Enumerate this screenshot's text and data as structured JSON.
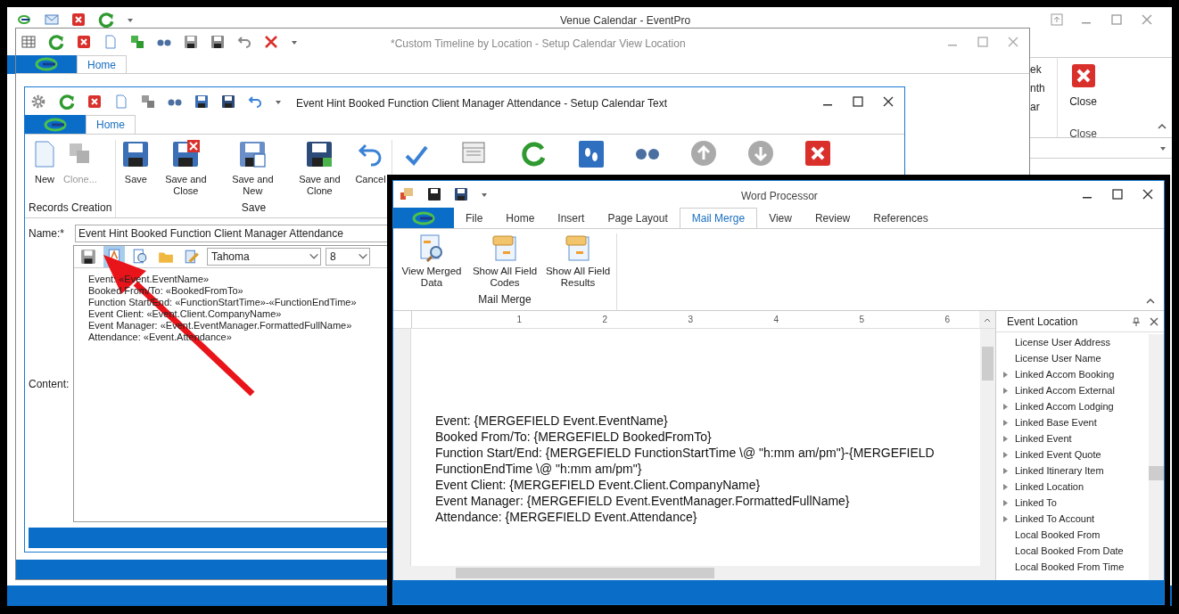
{
  "main_window": {
    "title": "Venue Calendar - EventPro",
    "ribbon_fragments": [
      "ek",
      "nth",
      "ar"
    ],
    "close_button": "Close",
    "close_group": "Close"
  },
  "timeline_window": {
    "title": "*Custom Timeline by Location - Setup Calendar View Location",
    "tab": "Home"
  },
  "text_window": {
    "title": "Event Hint Booked Function Client Manager Attendance - Setup Calendar Text",
    "tab": "Home",
    "groups": [
      {
        "label": "Records Creation",
        "buttons": [
          {
            "label": "New",
            "kind": "new",
            "disabled": false
          },
          {
            "label": "Clone...",
            "kind": "clone",
            "disabled": true
          }
        ]
      },
      {
        "label": "Save",
        "buttons": [
          {
            "label": "Save",
            "kind": "save",
            "disabled": false
          },
          {
            "label": "Save and Close",
            "kind": "save_close",
            "disabled": false
          },
          {
            "label": "Save and New",
            "kind": "save_new",
            "disabled": false
          },
          {
            "label": "Save and Clone",
            "kind": "save_clone",
            "disabled": false
          },
          {
            "label": "Cancel",
            "kind": "cancel",
            "disabled": false
          }
        ]
      }
    ],
    "name_label": "Name:*",
    "name_value": "Event Hint Booked Function Client Manager Attendance",
    "editor_toolbar": [
      {
        "kind": "save",
        "highlighted": false
      },
      {
        "kind": "text",
        "highlighted": true
      },
      {
        "kind": "find",
        "highlighted": false
      },
      {
        "kind": "open",
        "highlighted": false
      },
      {
        "kind": "edit",
        "highlighted": false
      }
    ],
    "font": "Tahoma",
    "font_size": "8",
    "content_label": "Content:",
    "content_lines": [
      "Event: «Event.EventName»",
      "Booked From/To: «BookedFromTo»",
      "Function Start/End: «FunctionStartTime»-«FunctionEndTime»",
      "Event Client: «Event.Client.CompanyName»",
      "Event Manager: «Event.EventManager.FormattedFullName»",
      "Attendance: «Event.Attendance»"
    ]
  },
  "word_processor": {
    "title": "Word Processor",
    "tabs": [
      {
        "label": "File",
        "selected": false
      },
      {
        "label": "Home",
        "selected": false
      },
      {
        "label": "Insert",
        "selected": false
      },
      {
        "label": "Page Layout",
        "selected": false
      },
      {
        "label": "Mail Merge",
        "selected": true
      },
      {
        "label": "View",
        "selected": false
      },
      {
        "label": "Review",
        "selected": false
      },
      {
        "label": "References",
        "selected": false
      }
    ],
    "buttons": [
      {
        "label": "View Merged Data",
        "kind": "view_merged"
      },
      {
        "label": "Show All Field Codes",
        "kind": "field_codes"
      },
      {
        "label": "Show All Field Results",
        "kind": "field_results"
      }
    ],
    "group": "Mail Merge",
    "ruler_numbers": [
      "1",
      "2",
      "3",
      "4",
      "5",
      "6"
    ],
    "document_lines": [
      "Event: {MERGEFIELD Event.EventName}",
      "Booked From/To: {MERGEFIELD BookedFromTo}",
      "Function Start/End: {MERGEFIELD FunctionStartTime \\@ \"h:mm am/pm\"}-{MERGEFIELD",
      "FunctionEndTime \\@ \"h:mm am/pm\"}",
      "Event Client: {MERGEFIELD Event.Client.CompanyName}",
      "Event Manager: {MERGEFIELD Event.EventManager.FormattedFullName}",
      "Attendance: {MERGEFIELD Event.Attendance}"
    ],
    "field_panel": {
      "title": "Event Location",
      "items": [
        {
          "label": "License User Address",
          "has_children": false
        },
        {
          "label": "License User Name",
          "has_children": false
        },
        {
          "label": "Linked Accom Booking",
          "has_children": true
        },
        {
          "label": "Linked Accom External",
          "has_children": true
        },
        {
          "label": "Linked Accom Lodging",
          "has_children": true
        },
        {
          "label": "Linked Base Event",
          "has_children": true
        },
        {
          "label": "Linked Event",
          "has_children": true
        },
        {
          "label": "Linked Event Quote",
          "has_children": true
        },
        {
          "label": "Linked Itinerary Item",
          "has_children": true
        },
        {
          "label": "Linked Location",
          "has_children": true
        },
        {
          "label": "Linked To",
          "has_children": true
        },
        {
          "label": "Linked To Account",
          "has_children": true
        },
        {
          "label": "Local Booked From",
          "has_children": false
        },
        {
          "label": "Local Booked From Date",
          "has_children": false
        },
        {
          "label": "Local Booked From Time",
          "has_children": false
        }
      ]
    }
  }
}
